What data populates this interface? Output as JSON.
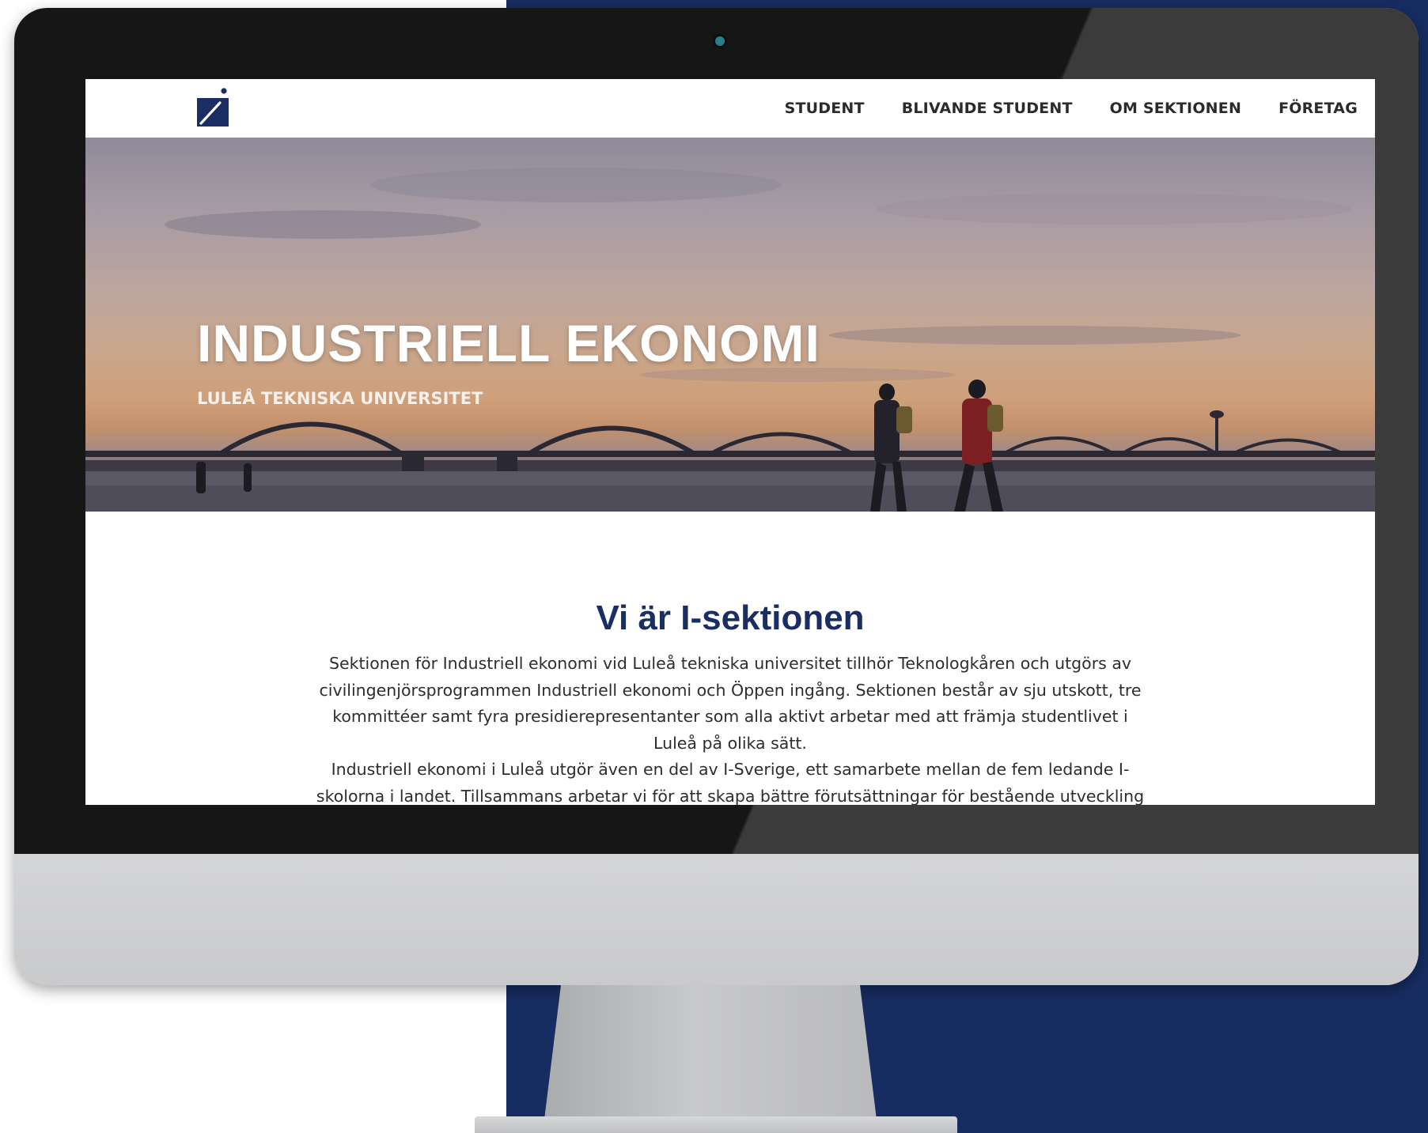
{
  "header": {
    "logo_name": "i-logo",
    "nav": [
      {
        "label": "STUDENT"
      },
      {
        "label": "BLIVANDE STUDENT"
      },
      {
        "label": "OM SEKTIONEN"
      },
      {
        "label": "FÖRETAG"
      }
    ]
  },
  "hero": {
    "title": "INDUSTRIELL EKONOMI",
    "subtitle": "LULEÅ TEKNISKA UNIVERSITET"
  },
  "content": {
    "title": "Vi är I-sektionen",
    "paragraph1": "Sektionen för Industriell ekonomi vid Luleå tekniska universitet tillhör Teknologkåren och utgörs av civilingenjörsprogrammen Industriell ekonomi och Öppen ingång. Sektionen består av sju utskott, tre kommittéer samt fyra presidierepresentanter som alla aktivt arbetar med att främja studentlivet i Luleå på olika sätt.",
    "paragraph2": "Industriell ekonomi i Luleå utgör även en del av I-Sverige, ett samarbete mellan de fem ledande I-skolorna i landet. Tillsammans arbetar vi för att skapa bättre förutsättningar för bestående utveckling av utbildningen såväl som"
  },
  "colors": {
    "brand_navy": "#1b2e63",
    "background_panel": "#172c61",
    "bezel": "#161616"
  }
}
